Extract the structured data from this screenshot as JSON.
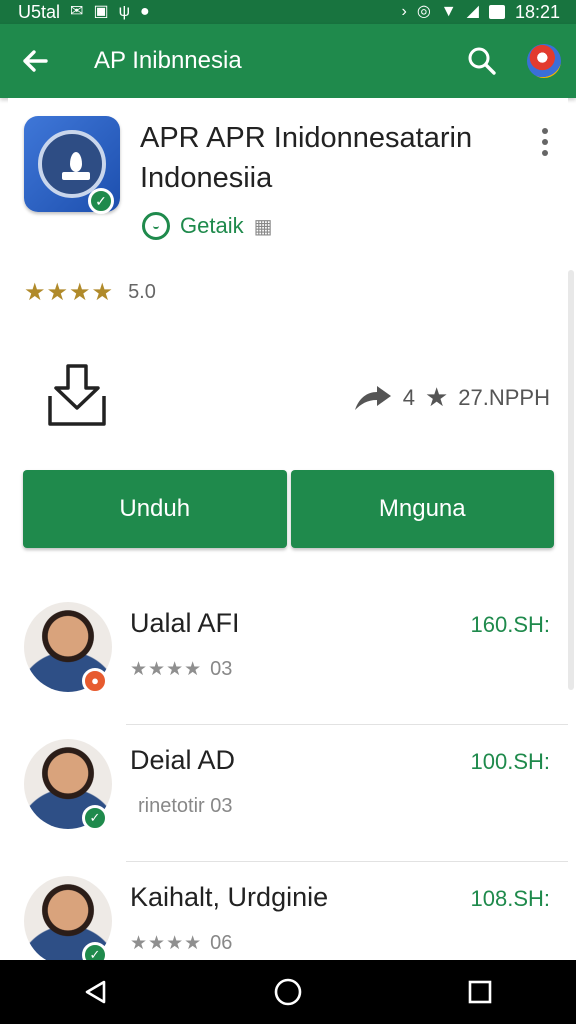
{
  "status_bar": {
    "left_text": "U5tal",
    "time": "18:21",
    "icons": [
      "mail-icon",
      "clipboard-icon",
      "antenna-icon",
      "alert-icon",
      "bluetooth-icon",
      "vibrate-icon",
      "wifi-icon",
      "signal-icon",
      "battery-icon"
    ]
  },
  "app_bar": {
    "title": "AP Inibnnesia",
    "icons": [
      "back-arrow-icon",
      "search-icon",
      "account-avatar"
    ]
  },
  "app": {
    "name": "APR APR Inidonnesatarin Indonesiia",
    "developer": "Getaik",
    "rating_stars": "★★★★",
    "rating_value": "5.0",
    "rating_fraction": 0.88,
    "downloads_count": "4",
    "size": "27.NPPH"
  },
  "actions": {
    "primary_label": "Unduh",
    "secondary_label": "Mnguna"
  },
  "list": [
    {
      "name": "Ualal AFI",
      "sub_stars": "★★★★",
      "sub_text": "03",
      "value": "160.SH:",
      "badge": "orange"
    },
    {
      "name": "Deial AD",
      "sub_stars": "",
      "sub_text": "rinetotir 03",
      "value": "100.SH:",
      "badge": "green"
    },
    {
      "name": "Kaihalt, Urdginie",
      "sub_stars": "★★★★",
      "sub_text": "06",
      "value": "108.SH:",
      "badge": "green"
    }
  ],
  "colors": {
    "primary": "#1f8a4c",
    "status_bar": "#18743f",
    "star": "#b08a2a"
  }
}
